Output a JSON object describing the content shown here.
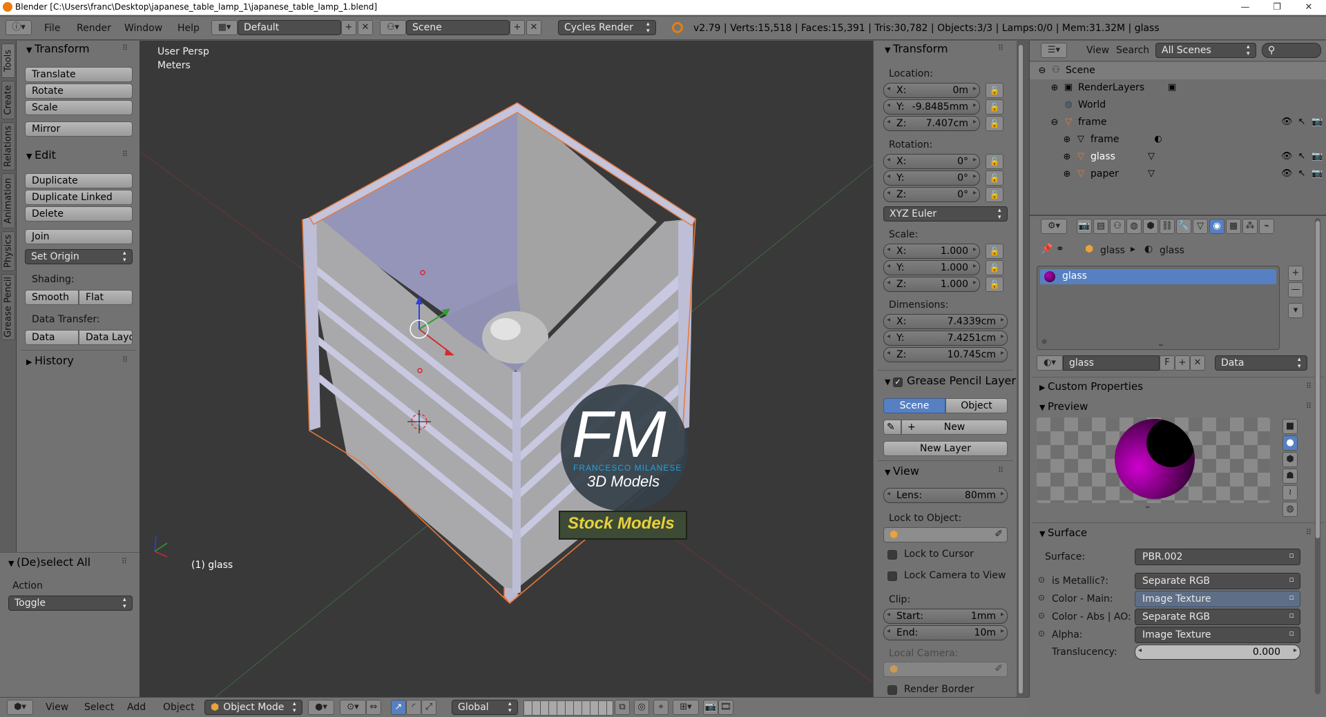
{
  "window": {
    "title": "Blender [C:\\Users\\franc\\Desktop\\japanese_table_lamp_1\\japanese_table_lamp_1.blend]",
    "minimize": "—",
    "maximize": "❐",
    "close": "✕"
  },
  "infobar": {
    "menus": [
      "File",
      "Render",
      "Window",
      "Help"
    ],
    "layout": "Default",
    "scene": "Scene",
    "engine": "Cycles Render",
    "stats": "v2.79 | Verts:15,518 | Faces:15,391 | Tris:30,782 | Objects:3/3 | Lamps:0/0 | Mem:31.32M | glass"
  },
  "left_tabs": [
    "Tools",
    "Create",
    "Relations",
    "Animation",
    "Physics",
    "Grease Pencil"
  ],
  "toolshelf": {
    "transform_title": "Transform",
    "transform_buttons": [
      "Translate",
      "Rotate",
      "Scale"
    ],
    "mirror": "Mirror",
    "edit_title": "Edit",
    "edit_buttons": [
      "Duplicate",
      "Duplicate Linked",
      "Delete"
    ],
    "join": "Join",
    "set_origin": "Set Origin",
    "shading_label": "Shading:",
    "smooth": "Smooth",
    "flat": "Flat",
    "data_transfer_label": "Data Transfer:",
    "data": "Data",
    "data_layout": "Data Layo",
    "history_title": "History"
  },
  "operator_panel": {
    "title": "(De)select All",
    "action_label": "Action",
    "action_value": "Toggle"
  },
  "viewport": {
    "view_name": "User Persp",
    "units": "Meters",
    "object_label": "(1) glass",
    "watermark": {
      "letters": "FM",
      "name": "FRANCESCO MILANESE",
      "subtitle": "3D Models",
      "banner": "Stock Models"
    }
  },
  "npanel": {
    "transform_title": "Transform",
    "location_label": "Location:",
    "location": [
      {
        "k": "X:",
        "v": "0m"
      },
      {
        "k": "Y:",
        "v": "-9.8485mm"
      },
      {
        "k": "Z:",
        "v": "7.407cm"
      }
    ],
    "rotation_label": "Rotation:",
    "rotation": [
      {
        "k": "X:",
        "v": "0°"
      },
      {
        "k": "Y:",
        "v": "0°"
      },
      {
        "k": "Z:",
        "v": "0°"
      }
    ],
    "rotation_mode": "XYZ Euler",
    "scale_label": "Scale:",
    "scale": [
      {
        "k": "X:",
        "v": "1.000"
      },
      {
        "k": "Y:",
        "v": "1.000"
      },
      {
        "k": "Z:",
        "v": "1.000"
      }
    ],
    "dimensions_label": "Dimensions:",
    "dimensions": [
      {
        "k": "X:",
        "v": "7.4339cm"
      },
      {
        "k": "Y:",
        "v": "7.4251cm"
      },
      {
        "k": "Z:",
        "v": "10.745cm"
      }
    ],
    "gp_title": "Grease Pencil Layer",
    "gp_scene": "Scene",
    "gp_object": "Object",
    "gp_new": "New",
    "gp_new_layer": "New Layer",
    "view_title": "View",
    "lens_label": "Lens:",
    "lens_value": "80mm",
    "lock_to_object": "Lock to Object:",
    "lock_to_cursor": "Lock to Cursor",
    "lock_camera": "Lock Camera to View",
    "clip_label": "Clip:",
    "clip_start_label": "Start:",
    "clip_start": "1mm",
    "clip_end_label": "End:",
    "clip_end": "10m",
    "local_camera": "Local Camera:",
    "render_border": "Render Border"
  },
  "outliner": {
    "view": "View",
    "search": "Search",
    "filter": "All Scenes",
    "rows": [
      {
        "label": "Scene"
      },
      {
        "label": "RenderLayers"
      },
      {
        "label": "World"
      },
      {
        "label": "frame"
      },
      {
        "label": "frame"
      },
      {
        "label": "glass"
      },
      {
        "label": "paper"
      }
    ]
  },
  "properties": {
    "breadcrumb_object": "glass",
    "breadcrumb_material": "glass",
    "slot": "glass",
    "material_name": "glass",
    "fake_user": "F",
    "link": "Data",
    "custom_properties": "Custom Properties",
    "preview": "Preview",
    "surface_title": "Surface",
    "surface_label": "Surface:",
    "surface_value": "PBR.002",
    "inputs": [
      {
        "label": "is Metallic?:",
        "value": "Separate RGB"
      },
      {
        "label": "Color - Main:",
        "value": "Image Texture"
      },
      {
        "label": "Color - Abs | AO:",
        "value": "Separate RGB"
      },
      {
        "label": "Alpha:",
        "value": "Image Texture"
      }
    ],
    "translucency_label": "Translucency:",
    "translucency_value": "0.000"
  },
  "bottombar": {
    "menus": [
      "View",
      "Select",
      "Add",
      "Object"
    ],
    "mode": "Object Mode",
    "orientation": "Global"
  },
  "colors": {
    "selection_outline": "#e8793c",
    "active_blue": "#5680c2",
    "watermark_blue": "#1fa3e0",
    "banner_yellow": "#e8d23a"
  }
}
